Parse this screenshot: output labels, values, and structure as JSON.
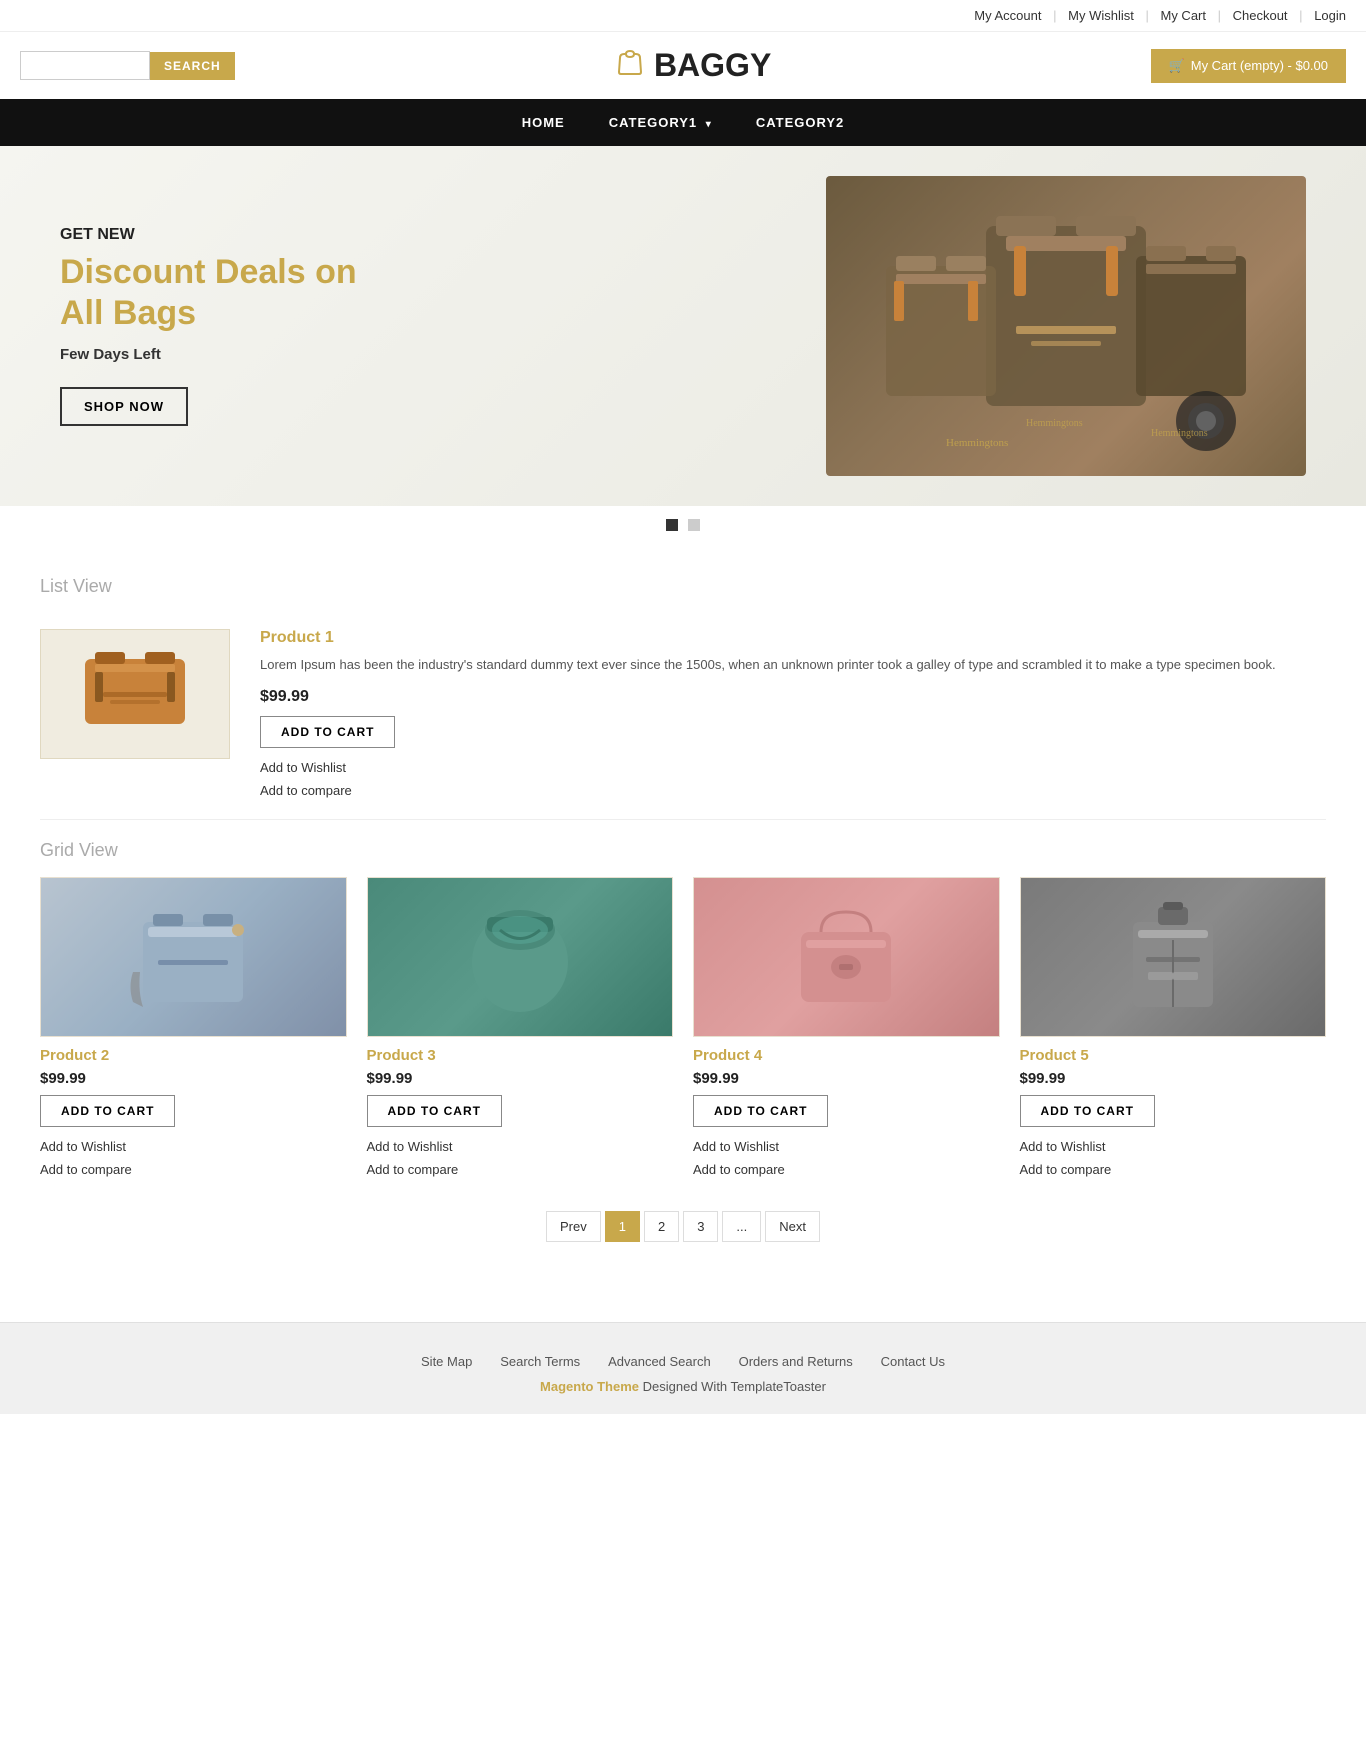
{
  "topbar": {
    "links": [
      {
        "label": "My Account",
        "id": "my-account"
      },
      {
        "label": "My Wishlist",
        "id": "my-wishlist"
      },
      {
        "label": "My Cart",
        "id": "my-cart"
      },
      {
        "label": "Checkout",
        "id": "checkout"
      },
      {
        "label": "Login",
        "id": "login"
      }
    ]
  },
  "header": {
    "search_placeholder": "",
    "search_button": "SEARCH",
    "logo_text": "BAGGY",
    "cart_button": "My Cart (empty) - $0.00"
  },
  "nav": {
    "items": [
      {
        "label": "HOME",
        "id": "home"
      },
      {
        "label": "CATEGORY1",
        "id": "category1",
        "has_dropdown": true
      },
      {
        "label": "CATEGORY2",
        "id": "category2"
      }
    ]
  },
  "hero": {
    "pre_title": "GET NEW",
    "title": "Discount Deals on All Bags",
    "subtitle": "Few Days Left",
    "cta": "SHOP NOW",
    "dots": [
      {
        "active": true
      },
      {
        "active": false
      }
    ]
  },
  "list_view": {
    "section_title": "List View",
    "product": {
      "name": "Product 1",
      "description": "Lorem Ipsum has been the industry's standard dummy text ever since the 1500s, when an unknown printer took a galley of type and scrambled it to make a type specimen book.",
      "price": "$99.99",
      "add_to_cart": "ADD TO CART",
      "wishlist": "Add to Wishlist",
      "compare": "Add to compare"
    }
  },
  "grid_view": {
    "section_title": "Grid View",
    "products": [
      {
        "name": "Product 2",
        "price": "$99.99",
        "add_to_cart": "ADD TO CART",
        "wishlist": "Add to Wishlist",
        "compare": "Add to compare",
        "bag_class": "bag-blue"
      },
      {
        "name": "Product 3",
        "price": "$99.99",
        "add_to_cart": "ADD TO CART",
        "wishlist": "Add to Wishlist",
        "compare": "Add to compare",
        "bag_class": "bag-teal"
      },
      {
        "name": "Product 4",
        "price": "$99.99",
        "add_to_cart": "ADD TO CART",
        "wishlist": "Add to Wishlist",
        "compare": "Add to compare",
        "bag_class": "bag-pink"
      },
      {
        "name": "Product 5",
        "price": "$99.99",
        "add_to_cart": "ADD TO CART",
        "wishlist": "Add to Wishlist",
        "compare": "Add to compare",
        "bag_class": "bag-gray"
      }
    ]
  },
  "pagination": {
    "prev": "Prev",
    "pages": [
      "1",
      "2",
      "3",
      "..."
    ],
    "next": "Next",
    "active_page": "1"
  },
  "footer": {
    "links": [
      {
        "label": "Site Map"
      },
      {
        "label": "Search Terms"
      },
      {
        "label": "Advanced Search"
      },
      {
        "label": "Orders and Returns"
      },
      {
        "label": "Contact Us"
      }
    ],
    "credit_brand": "Magento Theme",
    "credit_text": " Designed With TemplateToaster"
  }
}
